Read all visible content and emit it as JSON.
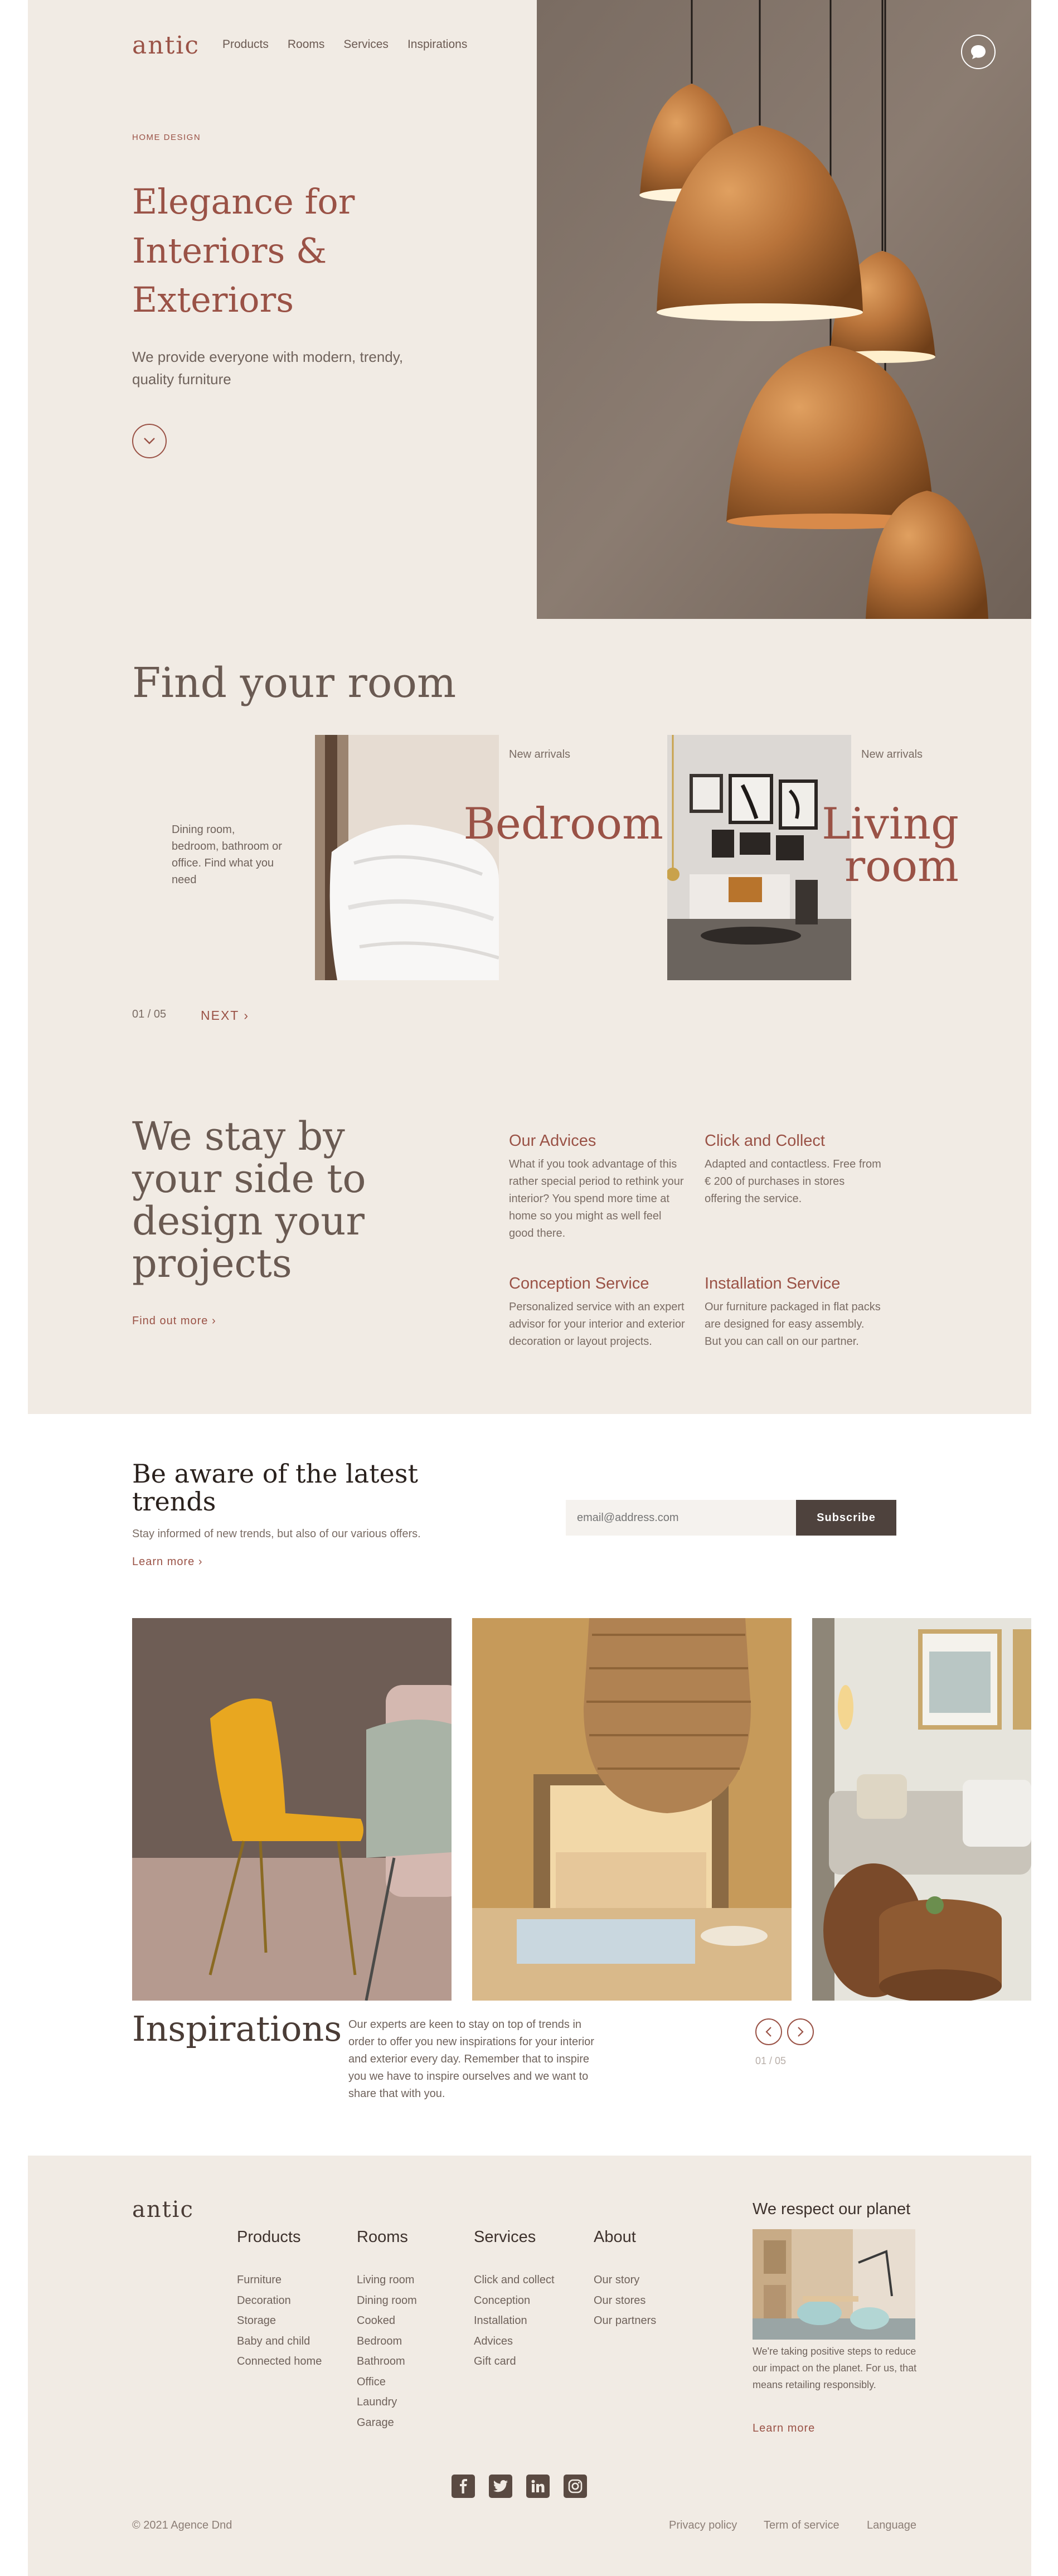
{
  "header": {
    "logo": "antic",
    "nav": [
      "Products",
      "Rooms",
      "Services",
      "Inspirations"
    ]
  },
  "hero": {
    "eyebrow": "HOME DESIGN",
    "title": "Elegance for Interiors & Exteriors",
    "subtitle": "We provide everyone with modern, trendy, quality furniture"
  },
  "rooms": {
    "title": "Find your room",
    "description": "Dining room, bedroom, bathroom or office. Find what you need",
    "cards": [
      {
        "tag": "New arrivals",
        "name_line1": "Bedroom",
        "name_line2": ""
      },
      {
        "tag": "New arrivals",
        "name_line1": "Living",
        "name_line2": "room"
      }
    ],
    "counter": "01 / 05",
    "next": "NEXT"
  },
  "services": {
    "title": "We stay by your side to design your projects",
    "cta": "Find out more",
    "items": [
      {
        "title": "Our Advices",
        "text": "What if you took advantage of this rather special period to rethink your interior? You spend more time at home so you might as well feel good there."
      },
      {
        "title": "Click and Collect",
        "text": "Adapted and contactless. Free from € 200 of purchases in stores offering the service."
      },
      {
        "title": "Conception Service",
        "text": "Personalized service with an expert advisor for your interior and exterior decoration or layout projects."
      },
      {
        "title": "Installation Service",
        "text": "Our furniture packaged in flat packs are designed for easy assembly. But you can call on our partner."
      }
    ]
  },
  "newsletter": {
    "title": "Be aware of the latest trends",
    "subtitle": "Stay informed of new trends, but also of our various offers.",
    "learn": "Learn more",
    "email_placeholder": "email@address.com",
    "subscribe": "Subscribe"
  },
  "inspirations": {
    "title": "Inspirations",
    "text": "Our experts are keen to stay on top of trends in order to offer you new inspirations for your interior and exterior every day. Remember that to inspire you we have to inspire ourselves and we want to share that with you.",
    "counter": "01 / 05"
  },
  "footer": {
    "logo": "antic",
    "columns": [
      {
        "title": "Products",
        "links": [
          "Furniture",
          "Decoration",
          "Storage",
          "Baby and child",
          "Connected home"
        ]
      },
      {
        "title": "Rooms",
        "links": [
          "Living room",
          "Dining room",
          "Cooked",
          "Bedroom",
          "Bathroom",
          "Office",
          "Laundry",
          "Garage"
        ]
      },
      {
        "title": "Services",
        "links": [
          "Click and collect",
          "Conception",
          "Installation",
          "Advices",
          "Gift card"
        ]
      },
      {
        "title": "About",
        "links": [
          "Our story",
          "Our stores",
          "Our partners"
        ]
      }
    ],
    "planet": {
      "title": "We respect our planet",
      "text": "We're taking positive steps to reduce our impact on the planet. For us, that means retailing responsibly.",
      "learn": "Learn more"
    },
    "social": [
      "facebook-icon",
      "twitter-icon",
      "linkedin-icon",
      "instagram-icon"
    ],
    "copyright": "© 2021 Agence Dnd",
    "legal": [
      "Privacy policy",
      "Term of service",
      "Language"
    ]
  },
  "colors": {
    "accent": "#9a5246",
    "background": "#f1ebe4",
    "dark": "#4e423d"
  }
}
